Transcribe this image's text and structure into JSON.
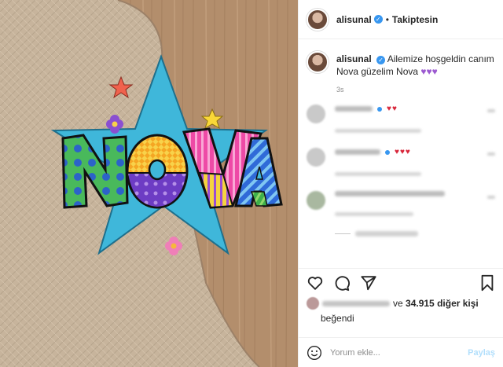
{
  "post": {
    "username": "alisunal",
    "follow_label": "Takiptesin",
    "dot": "•",
    "caption": "Ailemize hoşgeldin canım Nova güzelim Nova",
    "caption_hearts": "♥♥♥",
    "time": "3s"
  },
  "artwork": {
    "letters": [
      "N",
      "O",
      "V",
      "A"
    ]
  },
  "comments": [
    {
      "hearts": "♥♥"
    },
    {
      "hearts": "♥♥♥"
    },
    {
      "hearts": ""
    }
  ],
  "likes": {
    "connector": "ve",
    "count_text": "34.915 diğer kişi",
    "liked_text": "beğendi"
  },
  "compose": {
    "placeholder": "Yorum ekle...",
    "share_label": "Paylaş"
  },
  "icons": {
    "heart": "heart-icon",
    "comment": "comment-icon",
    "share": "send-icon",
    "save": "bookmark-icon",
    "emoji": "emoji-icon",
    "verified": "verified-icon"
  },
  "colors": {
    "verified": "#3897f0",
    "star": "#3fb7da",
    "hearts": "#9b59d0",
    "share_disabled": "#b2dffc"
  }
}
